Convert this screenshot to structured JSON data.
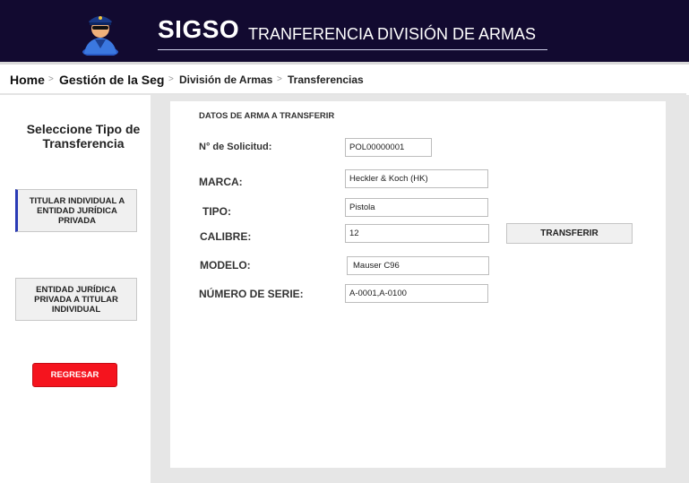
{
  "header": {
    "app_name": "SIGSO",
    "subtitle": "TRANFERENCIA DIVISIÓN DE ARMAS",
    "logo_icon": "police-officer-icon",
    "background": "#120a30"
  },
  "breadcrumb": {
    "items": [
      "Home",
      "Gestión de la Seg",
      "División de Armas",
      "Transferencias"
    ],
    "separator": ">"
  },
  "sidebar": {
    "title": "Seleccione Tipo de Transferencia",
    "options": [
      {
        "label": "TITULAR INDIVIDUAL A ENTIDAD JURÍDICA PRIVADA",
        "selected": true
      },
      {
        "label": "ENTIDAD JURÍDICA PRIVADA A TITULAR INDIVIDUAL",
        "selected": false
      }
    ],
    "back_label": "REGRESAR",
    "back_color": "#f5141e"
  },
  "form": {
    "title": "DATOS DE ARMA A TRANSFERIR",
    "solicitud": {
      "label": "N° de Solicitud:",
      "value": "POL00000001"
    },
    "marca": {
      "label": "MARCA:",
      "value": "Heckler & Koch (HK)"
    },
    "tipo": {
      "label": "TIPO:",
      "value": "Pistola"
    },
    "calibre": {
      "label": "CALIBRE:",
      "value": "12"
    },
    "modelo": {
      "label": "MODELO:",
      "value": "Mauser C96"
    },
    "serie": {
      "label": "NÚMERO DE SERIE:",
      "value": "A-0001,A-0100"
    },
    "transfer_label": "TRANSFERIR"
  }
}
